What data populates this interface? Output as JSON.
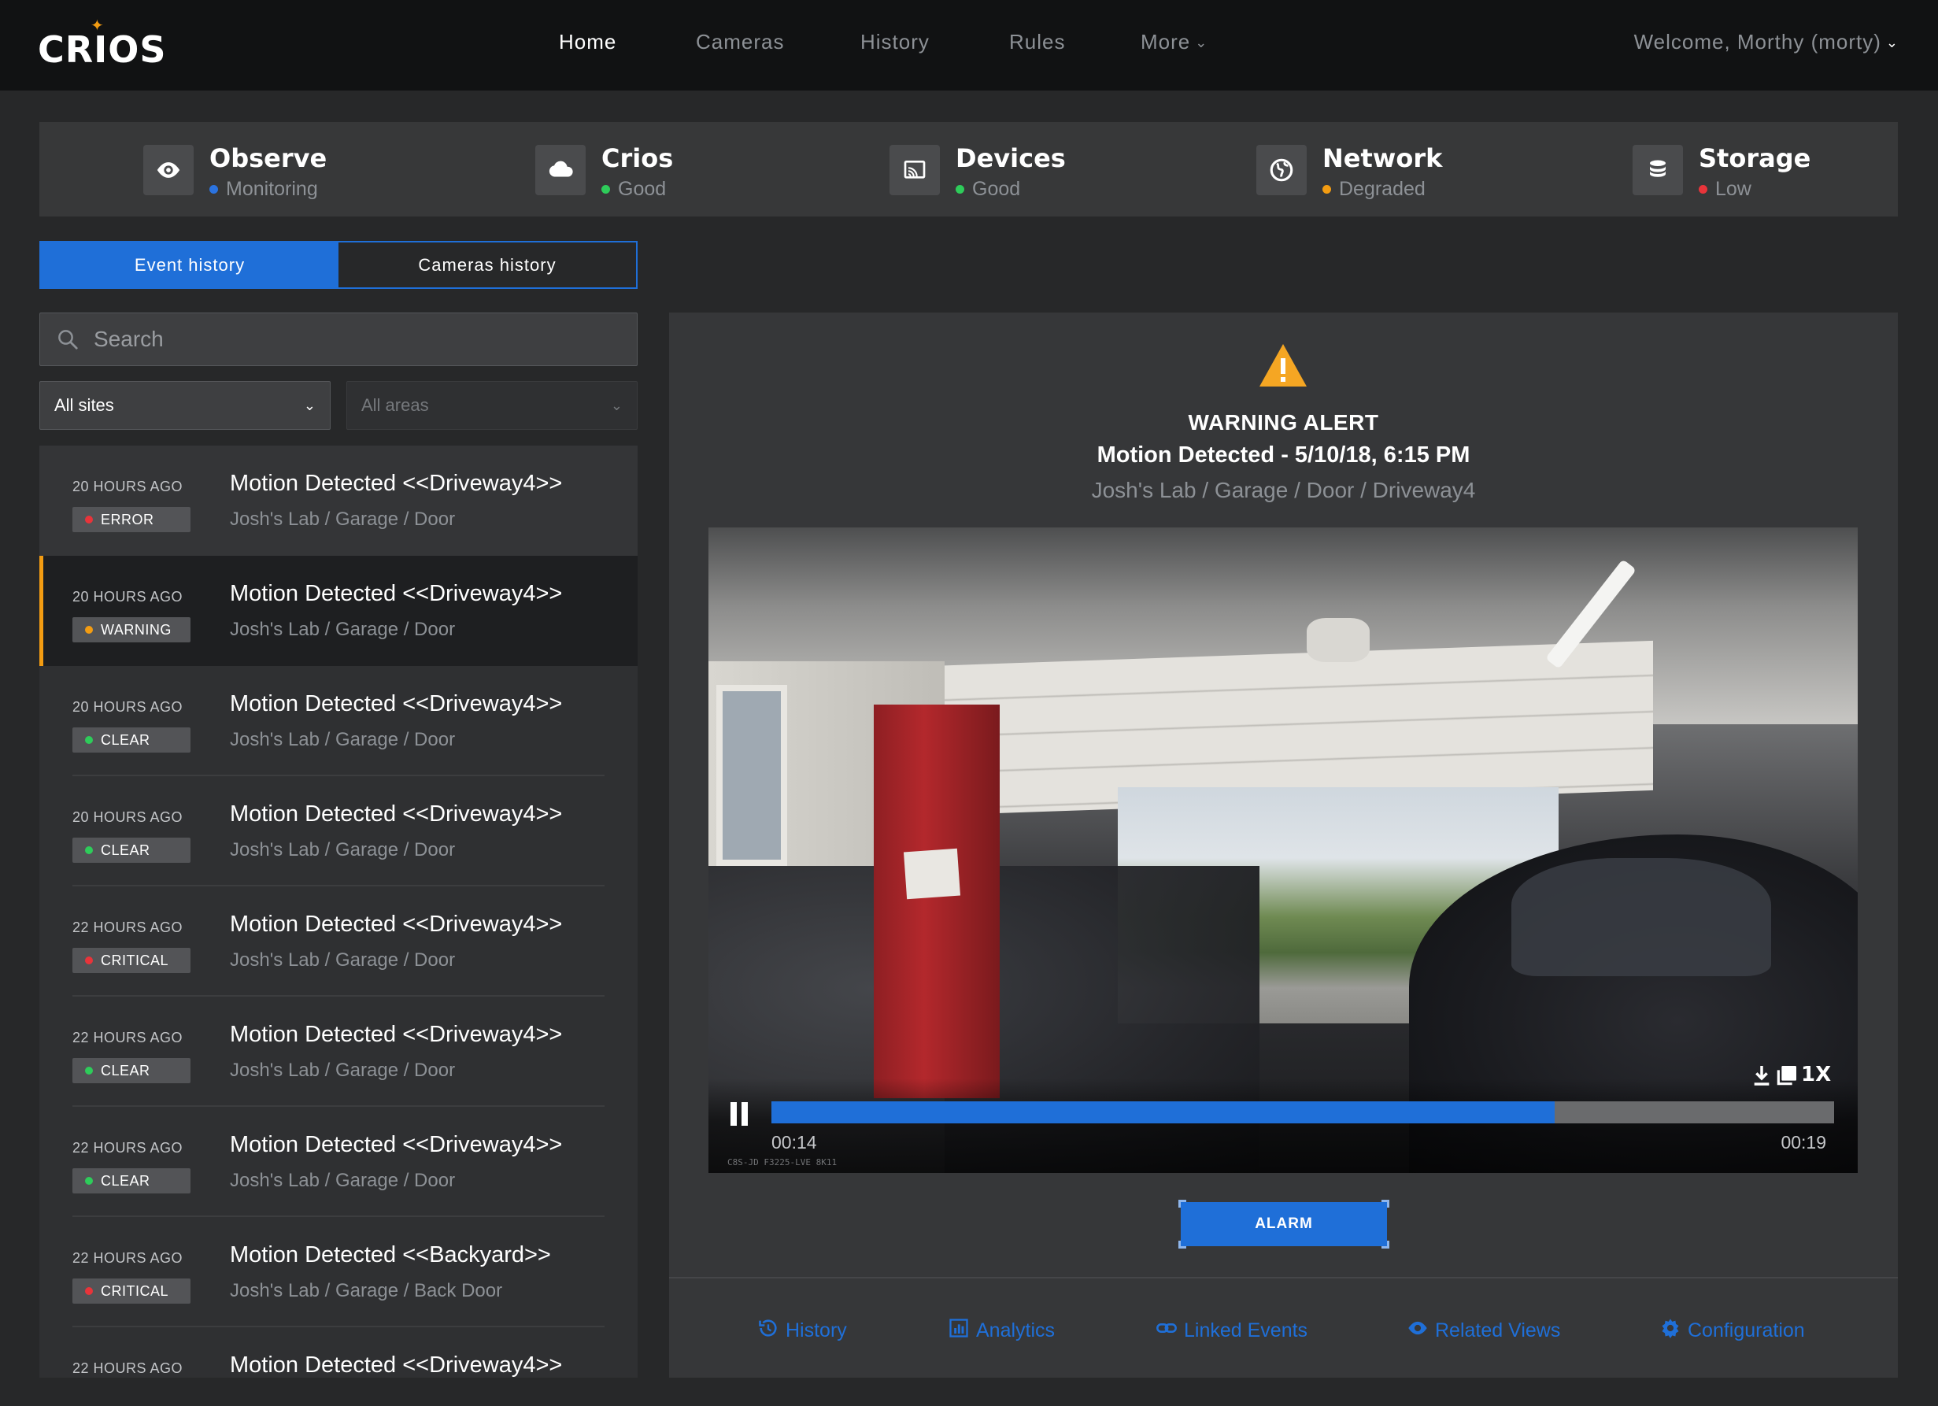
{
  "app": {
    "logo": "CRIOS"
  },
  "nav": {
    "items": [
      {
        "label": "Home",
        "active": true
      },
      {
        "label": "Cameras",
        "active": false
      },
      {
        "label": "History",
        "active": false
      },
      {
        "label": "Rules",
        "active": false
      },
      {
        "label": "More",
        "active": false
      }
    ],
    "welcome": "Welcome, Morthy (morty)"
  },
  "status": [
    {
      "name": "Observe",
      "state": "Monitoring",
      "state_color": "#2b73e0",
      "icon": "eye-icon"
    },
    {
      "name": "Crios",
      "state": "Good",
      "state_color": "#2ecc5a",
      "icon": "cloud-icon"
    },
    {
      "name": "Devices",
      "state": "Good",
      "state_color": "#2ecc5a",
      "icon": "cast-icon"
    },
    {
      "name": "Network",
      "state": "Degraded",
      "state_color": "#f39c12",
      "icon": "globe-icon"
    },
    {
      "name": "Storage",
      "state": "Low",
      "state_color": "#e8343a",
      "icon": "database-icon"
    }
  ],
  "tabs": [
    {
      "label": "Event history",
      "active": true
    },
    {
      "label": "Cameras history",
      "active": false
    }
  ],
  "search": {
    "placeholder": "Search",
    "value": ""
  },
  "filters": {
    "sites": "All sites",
    "areas": "All areas"
  },
  "events": [
    {
      "time": "20 HOURS AGO",
      "severity": "ERROR",
      "severity_color": "#e8343a",
      "title": "Motion Detected <<Driveway4>>",
      "path": "Josh's Lab / Garage / Door"
    },
    {
      "time": "20 HOURS AGO",
      "severity": "WARNING",
      "severity_color": "#f39c12",
      "title": "Motion Detected <<Driveway4>>",
      "path": "Josh's Lab / Garage / Door"
    },
    {
      "time": "20 HOURS AGO",
      "severity": "CLEAR",
      "severity_color": "#2ecc5a",
      "title": "Motion Detected <<Driveway4>>",
      "path": "Josh's Lab / Garage / Door"
    },
    {
      "time": "20 HOURS AGO",
      "severity": "CLEAR",
      "severity_color": "#2ecc5a",
      "title": "Motion Detected <<Driveway4>>",
      "path": "Josh's Lab / Garage / Door"
    },
    {
      "time": "22 HOURS AGO",
      "severity": "CRITICAL",
      "severity_color": "#e8343a",
      "title": "Motion Detected <<Driveway4>>",
      "path": "Josh's Lab / Garage / Door"
    },
    {
      "time": "22 HOURS AGO",
      "severity": "CLEAR",
      "severity_color": "#2ecc5a",
      "title": "Motion Detected <<Driveway4>>",
      "path": "Josh's Lab / Garage / Door"
    },
    {
      "time": "22 HOURS AGO",
      "severity": "CLEAR",
      "severity_color": "#2ecc5a",
      "title": "Motion Detected <<Driveway4>>",
      "path": "Josh's Lab / Garage / Door"
    },
    {
      "time": "22 HOURS AGO",
      "severity": "CRITICAL",
      "severity_color": "#e8343a",
      "title": "Motion Detected <<Backyard>>",
      "path": "Josh's Lab / Garage / Back Door"
    },
    {
      "time": "22 HOURS AGO",
      "severity": "",
      "severity_color": "#e8343a",
      "title": "Motion Detected <<Driveway4>>",
      "path": ""
    }
  ],
  "detail": {
    "alert_type": "WARNING ALERT",
    "title": "Motion Detected - 5/10/18, 6:15 PM",
    "path": "Josh's Lab / Garage / Door / Driveway4",
    "video": {
      "speed": "1X",
      "current_time": "00:14",
      "duration": "00:19",
      "progress": 0.73684
    },
    "alarm_button": "ALARM",
    "footer_links": [
      {
        "label": "History",
        "icon": "history-icon"
      },
      {
        "label": "Analytics",
        "icon": "bar-chart-icon"
      },
      {
        "label": "Linked Events",
        "icon": "link-icon"
      },
      {
        "label": "Related Views",
        "icon": "eye-icon"
      },
      {
        "label": "Configuration",
        "icon": "gear-icon"
      }
    ]
  },
  "colors": {
    "accent": "#1f6fd8",
    "warning": "#f39c12",
    "error": "#e8343a",
    "clear": "#2ecc5a",
    "background": "#272829"
  }
}
